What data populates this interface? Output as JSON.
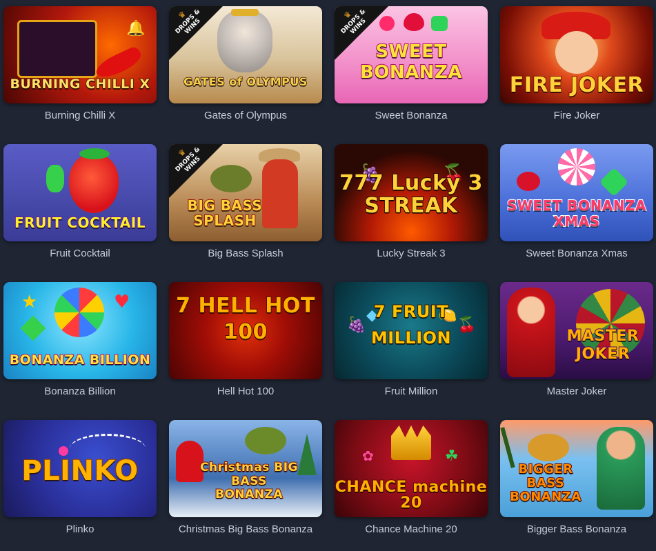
{
  "games": [
    {
      "label": "Burning Chilli X",
      "art_title": "BURNING CHILLI X",
      "icon": "chilli-pepper-icon",
      "bg": "#7a0f0a",
      "accent": "#ffb300",
      "badge": false
    },
    {
      "label": "Gates of Olympus",
      "art_title": "GATES of OLYMPUS",
      "icon": "zeus-icon",
      "bg": "#d9c7a6",
      "accent": "#f2c230",
      "badge": true
    },
    {
      "label": "Sweet Bonanza",
      "art_title": "SWEET BONANZA",
      "icon": "candy-icon",
      "bg": "#f3a6d3",
      "accent": "#ffd23f",
      "badge": true
    },
    {
      "label": "Fire Joker",
      "art_title": "FIRE JOKER",
      "icon": "joker-icon",
      "bg": "#8a1c0b",
      "accent": "#ffb000",
      "badge": false
    },
    {
      "label": "Fruit Cocktail",
      "art_title": "FRUIT COCKTAIL",
      "icon": "strawberry-icon",
      "bg": "#3b3f9a",
      "accent": "#ffe000",
      "badge": false
    },
    {
      "label": "Big Bass Splash",
      "art_title": "BIG BASS SPLASH",
      "icon": "fisherman-icon",
      "bg": "#b98a55",
      "accent": "#f2c230",
      "badge": true
    },
    {
      "label": "Lucky Streak 3",
      "art_title": "777 Lucky 3 STREAK",
      "icon": "sevens-icon",
      "bg": "#2a0804",
      "accent": "#ffd000",
      "badge": false
    },
    {
      "label": "Sweet Bonanza Xmas",
      "art_title": "SWEET BONANZA XMAS",
      "icon": "lollipop-icon",
      "bg": "#3d7fe0",
      "accent": "#ff3b6b",
      "badge": false
    },
    {
      "label": "Bonanza Billion",
      "art_title": "BONANZA BILLION",
      "icon": "candy-flower-icon",
      "bg": "#28b6e8",
      "accent": "#ffd000",
      "badge": false
    },
    {
      "label": "Hell Hot 100",
      "art_title": "7 HELL HOT 100",
      "icon": "seven-icon",
      "bg": "#7a0706",
      "accent": "#ff9b00",
      "badge": false
    },
    {
      "label": "Fruit Million",
      "art_title": "7 FRUIT MILLION",
      "icon": "fruits-icon",
      "bg": "#0b4a5a",
      "accent": "#ffc400",
      "badge": false
    },
    {
      "label": "Master Joker",
      "art_title": "MASTER JOKER",
      "icon": "jester-icon",
      "bg": "#4a1a6e",
      "accent": "#ffb000",
      "badge": false
    },
    {
      "label": "Plinko",
      "art_title": "PLINKO",
      "icon": "ball-icon",
      "bg": "#2a2f9a",
      "accent": "#ffb300",
      "badge": false
    },
    {
      "label": "Christmas Big Bass Bonanza",
      "art_title": "Christmas BIG BASS BONANZA",
      "icon": "santa-icon",
      "bg": "#3f6fb0",
      "accent": "#f2c230",
      "badge": false
    },
    {
      "label": "Chance Machine 20",
      "art_title": "CHANCE machine 20",
      "icon": "crown-icon",
      "bg": "#7a0b14",
      "accent": "#ffb000",
      "badge": false
    },
    {
      "label": "Bigger Bass Bonanza",
      "art_title": "BIGGER BASS BONANZA",
      "icon": "fishing-frog-icon",
      "bg": "#4aa0d8",
      "accent": "#ff8a00",
      "badge": false
    }
  ],
  "badge_text": "DROPS & WINS"
}
